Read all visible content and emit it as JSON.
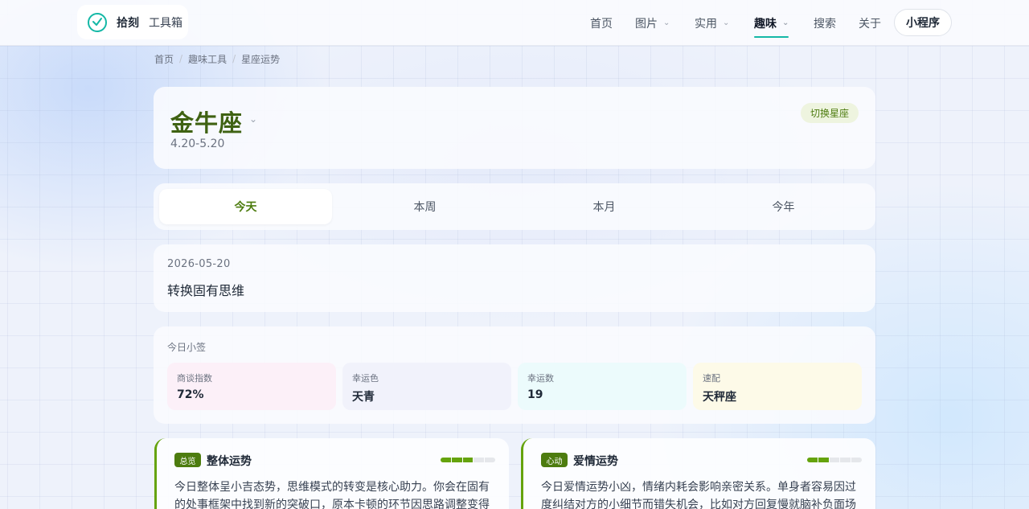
{
  "brand": {
    "name": "拾刻",
    "subtitle": "工具箱",
    "accent": "#14b8a6"
  },
  "nav": {
    "home": "首页",
    "images": "图片",
    "utility": "实用",
    "fun": "趣味",
    "search": "搜索",
    "about": "关于",
    "mini_program": "小程序",
    "active": "趣味"
  },
  "breadcrumb": [
    "首页",
    "趣味工具",
    "星座运势"
  ],
  "sign": {
    "name": "金牛座",
    "range": "4.20-5.20",
    "switch_label": "切换星座",
    "color": "#3f6212"
  },
  "tabs": [
    {
      "label": "今天",
      "active": true
    },
    {
      "label": "本周",
      "active": false
    },
    {
      "label": "本月",
      "active": false
    },
    {
      "label": "今年",
      "active": false
    }
  ],
  "quote": {
    "date": "2026-05-20",
    "text": "转换固有思维"
  },
  "stats": {
    "title": "今日小签",
    "items": [
      {
        "label": "商谈指数",
        "value": "72%",
        "bg": "#fcf0f8"
      },
      {
        "label": "幸运色",
        "value": "天青",
        "bg": "#f1f2fb"
      },
      {
        "label": "幸运数",
        "value": "19",
        "bg": "#ecfbfc"
      },
      {
        "label": "速配",
        "value": "天秤座",
        "bg": "#fdfae8"
      }
    ]
  },
  "fortunes": [
    {
      "badge": "总览",
      "title": "整体运势",
      "level": 0.6,
      "text": "今日整体呈小吉态势，思维模式的转变是核心助力。你会在固有的处事框架中找到新的突破口，原本卡顿的环节因思路调整变得"
    },
    {
      "badge": "心动",
      "title": "爱情运势",
      "level": 0.4,
      "text": "今日爱情运势小凶，情绪内耗会影响亲密关系。单身者容易因过度纠结对方的小细节而错失机会，比如对方回复慢就脑补负面场"
    }
  ]
}
